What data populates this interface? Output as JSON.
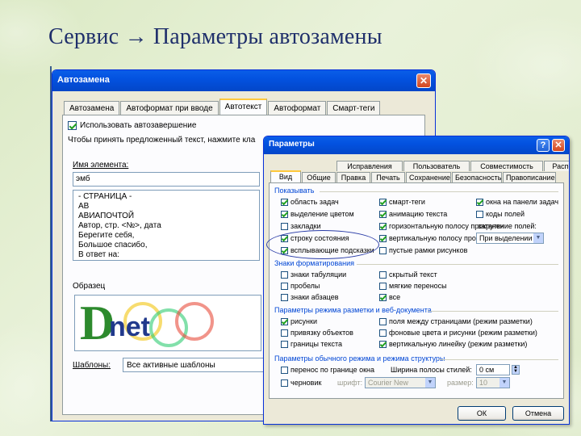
{
  "slide": {
    "title": "Сервис → Параметры автозамены"
  },
  "autocorrect": {
    "title": "Автозамена",
    "close": "✕",
    "tabs": [
      {
        "label": "Автозамена"
      },
      {
        "label": "Автоформат при вводе"
      },
      {
        "label": "Автотекст"
      },
      {
        "label": "Автоформат"
      },
      {
        "label": "Смарт-теги"
      }
    ],
    "use_autocomplete": "Использовать автозавершение",
    "hint": "Чтобы принять предложенный текст, нажмите кла",
    "name_label": "Имя элемента:",
    "name_value": "эмб",
    "entries": [
      "- СТРАНИЦА -",
      "АВ",
      "АВИАПОЧТОЙ",
      "Автор, стр. <№>, дата",
      "Берегите себя,",
      "Большое спасибо,",
      "В ответ на:"
    ],
    "sample_label": "Образец",
    "logo_d": "D",
    "logo_rest": "net",
    "templates_label": "Шаблоны:",
    "templates_value": "Все активные шаблоны"
  },
  "options": {
    "title": "Параметры",
    "help": "?",
    "close": "✕",
    "tabs_row1": [
      "Исправления",
      "Пользователь",
      "Совместимость",
      "Расположение"
    ],
    "tabs_row2": [
      "Вид",
      "Общие",
      "Правка",
      "Печать",
      "Сохранение",
      "Безопасность",
      "Правописание"
    ],
    "group_show": "Показывать",
    "show_options": [
      {
        "label": "область задач",
        "checked": true
      },
      {
        "label": "смарт-теги",
        "checked": true
      },
      {
        "label": "окна на панели задач",
        "checked": true
      },
      {
        "label": "выделение цветом",
        "checked": true
      },
      {
        "label": "анимацию текста",
        "checked": true
      },
      {
        "label": "коды полей",
        "checked": false
      },
      {
        "label": "закладки",
        "checked": false
      },
      {
        "label": "горизонтальную полосу прокрутки",
        "checked": true
      },
      {
        "label": "затенение полей:",
        "checked": false
      },
      {
        "label": "строку состояния",
        "checked": true
      },
      {
        "label": "вертикальную полосу прокрутки",
        "checked": true
      },
      {
        "label": "всплывающие подсказки",
        "checked": true
      },
      {
        "label": "пустые рамки рисунков",
        "checked": false
      }
    ],
    "field_shading_value": "При выделении",
    "group_marks": "Знаки форматирования",
    "marks_options": [
      {
        "label": "знаки табуляции",
        "checked": false
      },
      {
        "label": "скрытый текст",
        "checked": false
      },
      {
        "label": "пробелы",
        "checked": false
      },
      {
        "label": "мягкие переносы",
        "checked": false
      },
      {
        "label": "знаки абзацев",
        "checked": false
      },
      {
        "label": "все",
        "checked": true
      }
    ],
    "group_layout": "Параметры режима разметки и веб-документа",
    "layout_options": [
      {
        "label": "рисунки",
        "checked": true
      },
      {
        "label": "поля между страницами (режим разметки)",
        "checked": false
      },
      {
        "label": "привязку объектов",
        "checked": false
      },
      {
        "label": "фоновые цвета и рисунки (режим разметки)",
        "checked": false
      },
      {
        "label": "границы текста",
        "checked": false
      },
      {
        "label": "вертикальную линейку (режим разметки)",
        "checked": true
      }
    ],
    "group_normal": "Параметры обычного режима и режима структуры",
    "normal_options": [
      {
        "label": "перенос по границе окна",
        "checked": false
      },
      {
        "label": "черновик",
        "checked": false
      }
    ],
    "style_area_label": "Ширина полосы стилей:",
    "style_area_value": "0 см",
    "font_label": "шрифт:",
    "font_value": "Courier New",
    "size_label": "размер:",
    "size_value": "10",
    "ok": "ОК",
    "cancel": "Отмена"
  }
}
